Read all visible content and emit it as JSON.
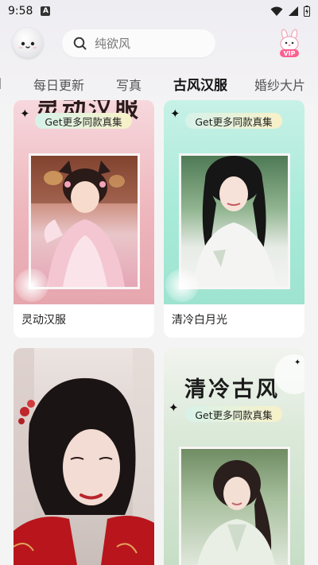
{
  "status_bar": {
    "time": "9:58",
    "notification_badge": "A",
    "icons": [
      "wifi-icon",
      "signal-icon",
      "battery-icon"
    ]
  },
  "header": {
    "search_placeholder": "纯欲风",
    "vip_label": "VIP"
  },
  "tabs": [
    {
      "label": "每日更新"
    },
    {
      "label": "写真"
    },
    {
      "label": "古风汉服",
      "active": true
    },
    {
      "label": "婚纱大片"
    }
  ],
  "cards": [
    {
      "title": "灵动汉服",
      "pill": "Get更多同款真集",
      "poster_title": "灵动汉服"
    },
    {
      "title": "清冷白月光",
      "pill": "Get更多同款真集"
    },
    {},
    {
      "pill": "Get更多同款真集",
      "poster_title": "清冷古风"
    }
  ],
  "colors": {
    "card1_bg": "#f2c2c8",
    "card2_bg": "#a7ead8",
    "card4_bg": "#cfe3cf",
    "pill_gradient_start": "#d7f2ea",
    "pill_gradient_end": "#f8f1c8"
  }
}
